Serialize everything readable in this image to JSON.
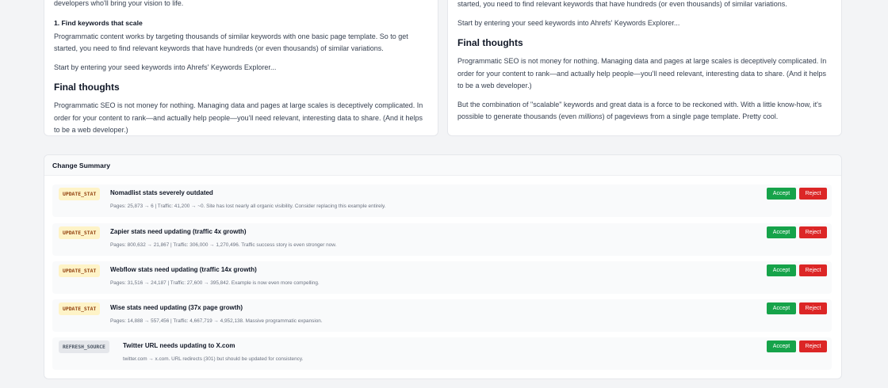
{
  "left_preview": {
    "para_intro": "developers who'll bring your vision to life.",
    "step_heading": "1. Find keywords that scale",
    "para_step": "Programmatic content works by targeting thousands of similar keywords with one basic page template. So to get started, you need to find relevant keywords that have hundreds (or even thousands) of similar variations.",
    "para_seed": "Start by entering your seed keywords into Ahrefs' Keywords Explorer...",
    "final_heading": "Final thoughts",
    "para_final": "Programmatic SEO is not money for nothing. Managing data and pages at large scales is deceptively complicated. In order for your content to rank—and actually help people—you'll need relevant, interesting data to share. (And it helps to be a web developer.)"
  },
  "right_preview": {
    "para_intro": "started, you need to find relevant keywords that have hundreds (or even thousands) of similar variations.",
    "para_seed": "Start by entering your seed keywords into Ahrefs' Keywords Explorer...",
    "final_heading": "Final thoughts",
    "para_final": "Programmatic SEO is not money for nothing. Managing data and pages at large scales is deceptively complicated. In order for your content to rank—and actually help people—you'll need relevant, interesting data to share. (And it helps to be a web developer.)",
    "para_combo_pre": "But the combination of \"scalable\" keywords and great data is a force to be reckoned with. With a little know-how, it's possible to generate thousands (even ",
    "para_combo_em": "millions",
    "para_combo_post": ") of pageviews from a single page template. Pretty cool."
  },
  "summary": {
    "title": "Change Summary",
    "accept_label": "Accept",
    "reject_label": "Reject",
    "changes": [
      {
        "tag": "UPDATE_STAT",
        "title": "Nomadlist stats severely outdated",
        "detail": "Pages: 25,873 → 6 | Traffic: 41,200 → ~0. Site has lost nearly all organic visibility. Consider replacing this example entirely."
      },
      {
        "tag": "UPDATE_STAT",
        "title": "Zapier stats need updating (traffic 4x growth)",
        "detail": "Pages: 800,632 → 21,867 | Traffic: 306,000 → 1,270,496. Traffic success story is even stronger now."
      },
      {
        "tag": "UPDATE_STAT",
        "title": "Webflow stats need updating (traffic 14x growth)",
        "detail": "Pages: 31,516 → 24,187 | Traffic: 27,600 → 395,842. Example is now even more compelling."
      },
      {
        "tag": "UPDATE_STAT",
        "title": "Wise stats need updating (37x page growth)",
        "detail": "Pages: 14,888 → 557,456 | Traffic: 4,667,719 → 4,952,138. Massive programmatic expansion."
      },
      {
        "tag": "REFRESH_SOURCE",
        "title": "Twitter URL needs updating to X.com",
        "detail": "twitter.com → x.com. URL redirects (301) but should be updated for consistency."
      }
    ]
  },
  "colors": {
    "accept": "#16a34a",
    "reject": "#dc2626",
    "tag_update_bg": "#fef3c7",
    "tag_update_text": "#92400e",
    "tag_refresh_bg": "#e5e7eb",
    "tag_refresh_text": "#4b5563"
  }
}
